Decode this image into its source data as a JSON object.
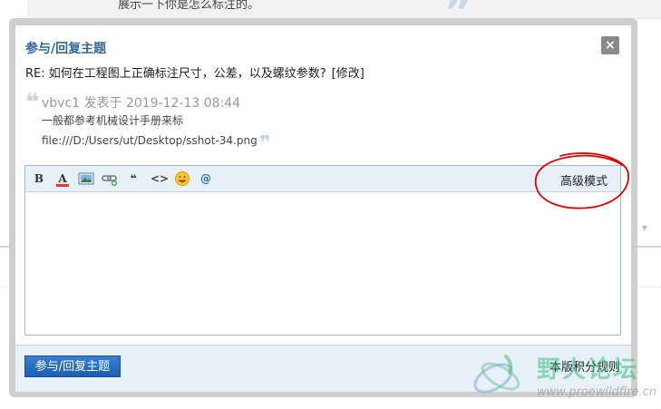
{
  "background": {
    "strip_text": "展示一下你是怎么标注的。",
    "right_text": "員 ▾"
  },
  "modal": {
    "title": "参与/回复主题",
    "close_label": "×",
    "thread_title": "RE: 如何在工程图上正确标注尺寸，公差，以及螺纹参数?",
    "edit_link": "[修改]",
    "quote": {
      "open_mark": "❝",
      "author_line": "vbvc1 发表于 2019-12-13 08:44",
      "line1": "一般都参考机械设计手册来标",
      "line2": "file:///D:/Users/ut/Desktop/sshot-34.png",
      "close_mark": "❞"
    },
    "editor": {
      "toolbar": {
        "bold_label": "B",
        "color_label": "A",
        "quote_label": "❝",
        "code_label": "<>",
        "at_label": "@",
        "advanced_mode_label": "高级模式"
      },
      "content": ""
    },
    "footer": {
      "submit_label": "参与/回复主题",
      "rules_label": "本版积分规则"
    }
  },
  "colors": {
    "title": "#336699",
    "submit_bg": "#2a6fc0",
    "annotation": "#e00000",
    "footer_bg": "#e8f0f8",
    "toolbar_bg": "#e8f0f7"
  },
  "watermark": {
    "text": "野火论坛",
    "url": "www.proewildfire.cn"
  }
}
